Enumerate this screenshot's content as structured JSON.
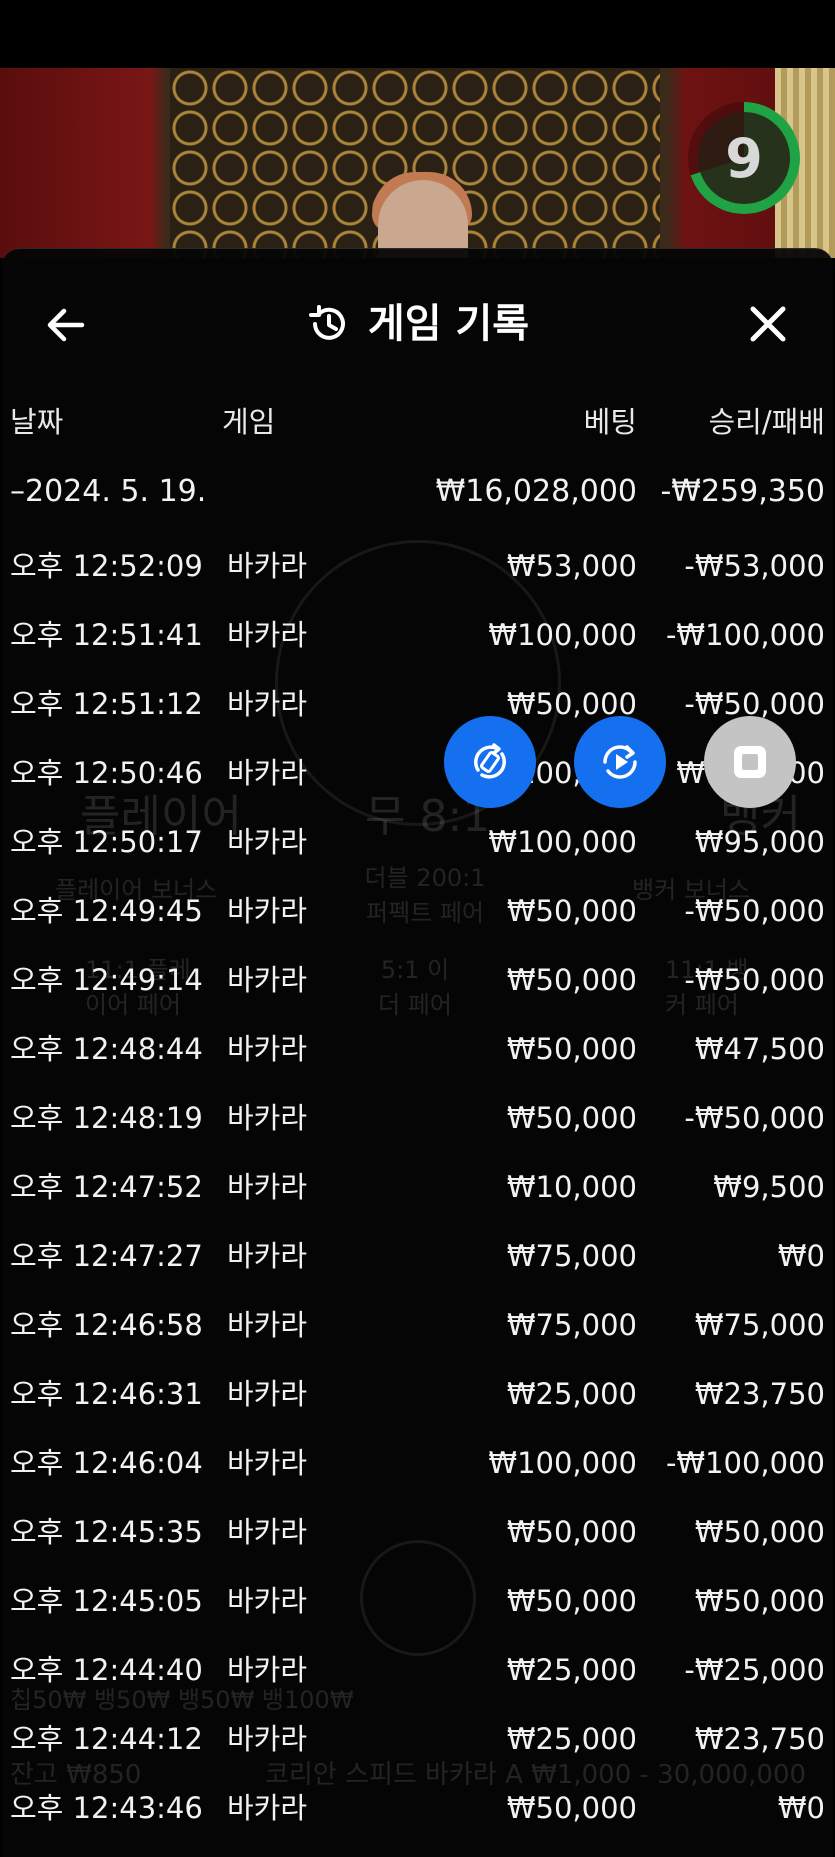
{
  "timer": {
    "value": "9"
  },
  "header": {
    "title": "게임 기록",
    "back_icon": "arrow-left-icon",
    "history_icon": "history-icon",
    "close_icon": "close-icon"
  },
  "columns": {
    "date": "날짜",
    "game": "게임",
    "bet": "베팅",
    "result": "승리/패배"
  },
  "date_group": {
    "date": "–2024. 5. 19.",
    "total_bet": "₩16,028,000",
    "total_result": "-₩259,350"
  },
  "rows": [
    {
      "time": "오후 12:52:09",
      "game": "바카라",
      "bet": "₩53,000",
      "result": "-₩53,000"
    },
    {
      "time": "오후 12:51:41",
      "game": "바카라",
      "bet": "₩100,000",
      "result": "-₩100,000"
    },
    {
      "time": "오후 12:51:12",
      "game": "바카라",
      "bet": "₩50,000",
      "result": "-₩50,000"
    },
    {
      "time": "오후 12:50:46",
      "game": "바카라",
      "bet": "₩100,000",
      "result": "₩190,000"
    },
    {
      "time": "오후 12:50:17",
      "game": "바카라",
      "bet": "₩100,000",
      "result": "₩95,000"
    },
    {
      "time": "오후 12:49:45",
      "game": "바카라",
      "bet": "₩50,000",
      "result": "-₩50,000"
    },
    {
      "time": "오후 12:49:14",
      "game": "바카라",
      "bet": "₩50,000",
      "result": "-₩50,000"
    },
    {
      "time": "오후 12:48:44",
      "game": "바카라",
      "bet": "₩50,000",
      "result": "₩47,500"
    },
    {
      "time": "오후 12:48:19",
      "game": "바카라",
      "bet": "₩50,000",
      "result": "-₩50,000"
    },
    {
      "time": "오후 12:47:52",
      "game": "바카라",
      "bet": "₩10,000",
      "result": "₩9,500"
    },
    {
      "time": "오후 12:47:27",
      "game": "바카라",
      "bet": "₩75,000",
      "result": "₩0"
    },
    {
      "time": "오후 12:46:58",
      "game": "바카라",
      "bet": "₩75,000",
      "result": "₩75,000"
    },
    {
      "time": "오후 12:46:31",
      "game": "바카라",
      "bet": "₩25,000",
      "result": "₩23,750"
    },
    {
      "time": "오후 12:46:04",
      "game": "바카라",
      "bet": "₩100,000",
      "result": "-₩100,000"
    },
    {
      "time": "오후 12:45:35",
      "game": "바카라",
      "bet": "₩50,000",
      "result": "₩50,000"
    },
    {
      "time": "오후 12:45:05",
      "game": "바카라",
      "bet": "₩50,000",
      "result": "₩50,000"
    },
    {
      "time": "오후 12:44:40",
      "game": "바카라",
      "bet": "₩25,000",
      "result": "-₩25,000"
    },
    {
      "time": "오후 12:44:12",
      "game": "바카라",
      "bet": "₩25,000",
      "result": "₩23,750"
    },
    {
      "time": "오후 12:43:46",
      "game": "바카라",
      "bet": "₩50,000",
      "result": "₩0"
    }
  ],
  "background_text": {
    "player": "플레이어",
    "tie": "무 8:1",
    "banker": "뱅커",
    "player_bonus": "플레이어 보너스",
    "perfect_pair": "더블 200:1 퍼펙트 페어",
    "banker_bonus": "뱅커 보너스",
    "player_pair": "11:1 플레이어 페어",
    "either_pair": "5:1 이더 페어",
    "banker_pair": "11:1 뱅커 페어",
    "chips": "칩50₩ 뱅50₩ 뱅50₩ 뱅100₩",
    "balance": "잔고 ₩850",
    "table": "코리안 스피드 바카라 A  ₩1,000 - 30,000,000"
  },
  "controls": {
    "rotate_icon": "rotate-icon",
    "replay_icon": "replay-icon",
    "stop_icon": "stop-icon"
  },
  "colors": {
    "accent_blue": "#1570ef",
    "timer_green": "#1fa344"
  }
}
